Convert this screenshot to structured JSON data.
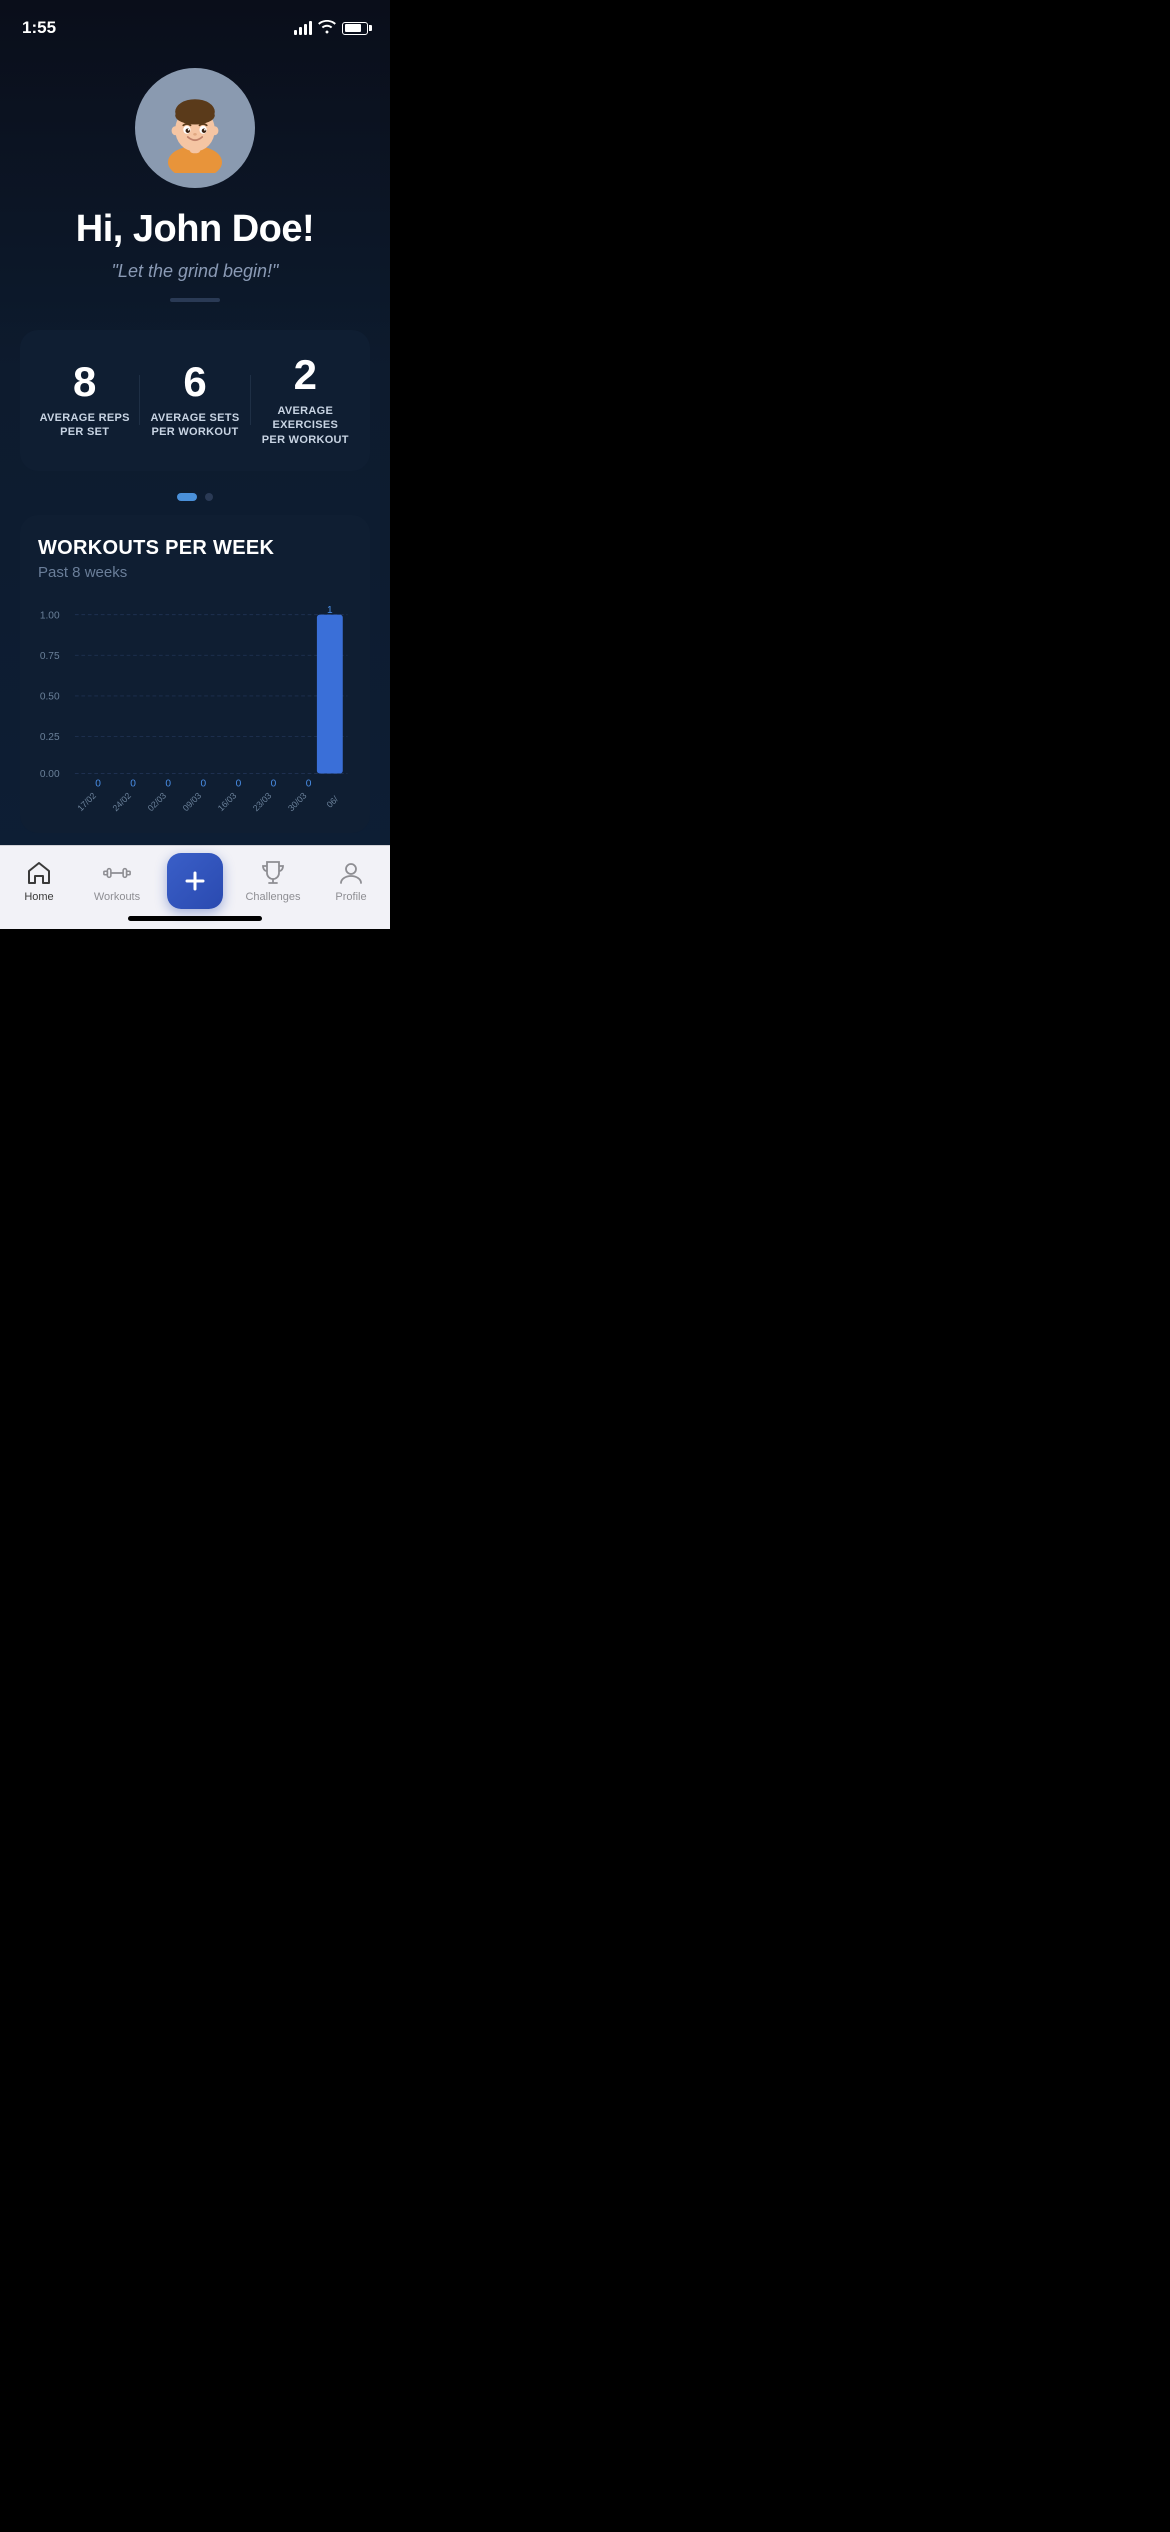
{
  "statusBar": {
    "time": "1:55"
  },
  "profile": {
    "greeting": "Hi, John Doe!",
    "motto": "\"Let the grind begin!\""
  },
  "stats": {
    "avgRepsValue": "8",
    "avgRepsLabel": "AVERAGE REPS\nPER SET",
    "avgSetsValue": "6",
    "avgSetsLabel": "AVERAGE SETS\nPER WORKOUT",
    "avgExercisesValue": "2",
    "avgExercisesLabel": "AVERAGE EXERCISES\nPER WORKOUT"
  },
  "chart": {
    "title": "WORKOUTS PER WEEK",
    "subtitle": "Past 8 weeks",
    "yLabels": [
      "1.00",
      "0.75",
      "0.50",
      "0.25",
      "0.00"
    ],
    "xLabels": [
      "17/02",
      "24/02",
      "02/03",
      "09/03",
      "16/03",
      "23/03",
      "30/03",
      "06/"
    ],
    "values": [
      0,
      0,
      0,
      0,
      0,
      0,
      0,
      1
    ],
    "activeValue": "1",
    "zeroLabel": "0"
  },
  "tabBar": {
    "home": "Home",
    "workouts": "Workouts",
    "challenges": "Challenges",
    "profile": "Profile"
  }
}
